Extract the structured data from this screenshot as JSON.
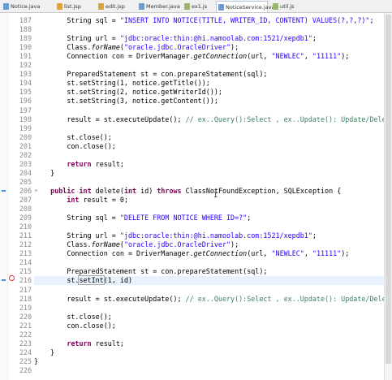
{
  "tabs": [
    {
      "label": "Notice.java",
      "type": "j"
    },
    {
      "label": "list.jsp",
      "type": "jsp"
    },
    {
      "label": "edit.jsp",
      "type": "jsp"
    },
    {
      "label": "Member.java",
      "type": "j"
    },
    {
      "label": "ex1.js",
      "type": "js"
    },
    {
      "label": "NoticeService.java",
      "type": "j",
      "active": true
    },
    {
      "label": "util.js",
      "type": "js"
    }
  ],
  "editor": {
    "line_numbers": [
      "187",
      "188",
      "189",
      "190",
      "191",
      "192",
      "193",
      "194",
      "195",
      "196",
      "197",
      "198",
      "199",
      "200",
      "201",
      "202",
      "203",
      "204",
      "205",
      "206",
      "207",
      "208",
      "209",
      "210",
      "211",
      "212",
      "213",
      "214",
      "215",
      "216",
      "217",
      "218",
      "219",
      "220",
      "221",
      "222",
      "223",
      "224",
      "225",
      "226"
    ],
    "fold_markers": [
      "⊖"
    ],
    "lines": [
      [
        {
          "t": "        String sql = "
        },
        {
          "c": "str",
          "t": "\"INSERT INTO NOTICE(TITLE, WRITER_ID, CONTENT) VALUES(?,?,?)\""
        },
        {
          "t": ";"
        }
      ],
      [],
      [
        {
          "t": "        String url = "
        },
        {
          "c": "str",
          "t": "\"jdbc:oracle:thin:@hi.namoolab.com:1521/xepdb1\""
        },
        {
          "t": ";"
        }
      ],
      [
        {
          "t": "        Class."
        },
        {
          "c": "ital",
          "t": "forName"
        },
        {
          "t": "("
        },
        {
          "c": "str",
          "t": "\"oracle.jdbc.OracleDriver\""
        },
        {
          "t": ");"
        }
      ],
      [
        {
          "t": "        Connection con = DriverManager."
        },
        {
          "c": "ital",
          "t": "getConnection"
        },
        {
          "t": "(url, "
        },
        {
          "c": "str",
          "t": "\"NEWLEC\""
        },
        {
          "t": ", "
        },
        {
          "c": "str",
          "t": "\"11111\""
        },
        {
          "t": ");"
        }
      ],
      [],
      [
        {
          "t": "        PreparedStatement st = con.prepareStatement(sql);"
        }
      ],
      [
        {
          "t": "        st.setString(1, notice.getTitle());"
        }
      ],
      [
        {
          "t": "        st.setString(2, notice.getWriterId());"
        }
      ],
      [
        {
          "t": "        st.setString(3, notice.getContent());"
        }
      ],
      [],
      [
        {
          "t": "        result = st.executeUpdate(); "
        },
        {
          "c": "cm",
          "t": "// ex..Query():Select , ex..Update(): Update/Delete"
        }
      ],
      [],
      [
        {
          "t": "        st.close();"
        }
      ],
      [
        {
          "t": "        con.close();"
        }
      ],
      [],
      [
        {
          "t": "        "
        },
        {
          "c": "kw",
          "t": "return"
        },
        {
          "t": " result;"
        }
      ],
      [
        {
          "t": "    }"
        }
      ],
      [],
      [
        {
          "t": "    "
        },
        {
          "c": "kw",
          "t": "public"
        },
        {
          "t": " "
        },
        {
          "c": "kw",
          "t": "int"
        },
        {
          "t": " delete("
        },
        {
          "c": "kw",
          "t": "int"
        },
        {
          "t": " id) "
        },
        {
          "c": "kw",
          "t": "throws"
        },
        {
          "t": " ClassNotFoundException, SQLException {"
        }
      ],
      [
        {
          "t": "        "
        },
        {
          "c": "kw",
          "t": "int"
        },
        {
          "t": " result = 0;"
        }
      ],
      [],
      [
        {
          "t": "        String sql = "
        },
        {
          "c": "str",
          "t": "\"DELETE FROM NOTICE WHERE ID=?\""
        },
        {
          "t": ";"
        }
      ],
      [],
      [
        {
          "t": "        String url = "
        },
        {
          "c": "str",
          "t": "\"jdbc:oracle:thin:@hi.namoolab.com:1521/xepdb1\""
        },
        {
          "t": ";"
        }
      ],
      [
        {
          "t": "        Class."
        },
        {
          "c": "ital",
          "t": "forName"
        },
        {
          "t": "("
        },
        {
          "c": "str",
          "t": "\"oracle.jdbc.OracleDriver\""
        },
        {
          "t": ");"
        }
      ],
      [
        {
          "t": "        Connection con = DriverManager."
        },
        {
          "c": "ital",
          "t": "getConnection"
        },
        {
          "t": "(url, "
        },
        {
          "c": "str",
          "t": "\"NEWLEC\""
        },
        {
          "t": ", "
        },
        {
          "c": "str",
          "t": "\"11111\""
        },
        {
          "t": ");"
        }
      ],
      [],
      [
        {
          "t": "        PreparedStatement st = con.prepareStatement(sql);"
        }
      ],
      [
        {
          "t": "        st."
        },
        {
          "c": "caret-box",
          "t": "setInt"
        },
        {
          "t": "(1, id)"
        }
      ],
      [],
      [
        {
          "t": "        result = st.executeUpdate(); "
        },
        {
          "c": "cm",
          "t": "// ex..Query():Select , ex..Update(): Update/Delete"
        }
      ],
      [],
      [
        {
          "t": "        st.close();"
        }
      ],
      [
        {
          "t": "        con.close();"
        }
      ],
      [],
      [
        {
          "t": "        "
        },
        {
          "c": "kw",
          "t": "return"
        },
        {
          "t": " result;"
        }
      ],
      [
        {
          "t": "    }"
        }
      ],
      [
        {
          "t": "}"
        }
      ],
      []
    ],
    "highlighted_line": "216",
    "error_line": "216"
  },
  "colors": {
    "keyword": "#7f0055",
    "string": "#2a00ff",
    "comment": "#3f7f5f",
    "line_highlight": "#e8f2fe",
    "error": "#dd3333"
  }
}
